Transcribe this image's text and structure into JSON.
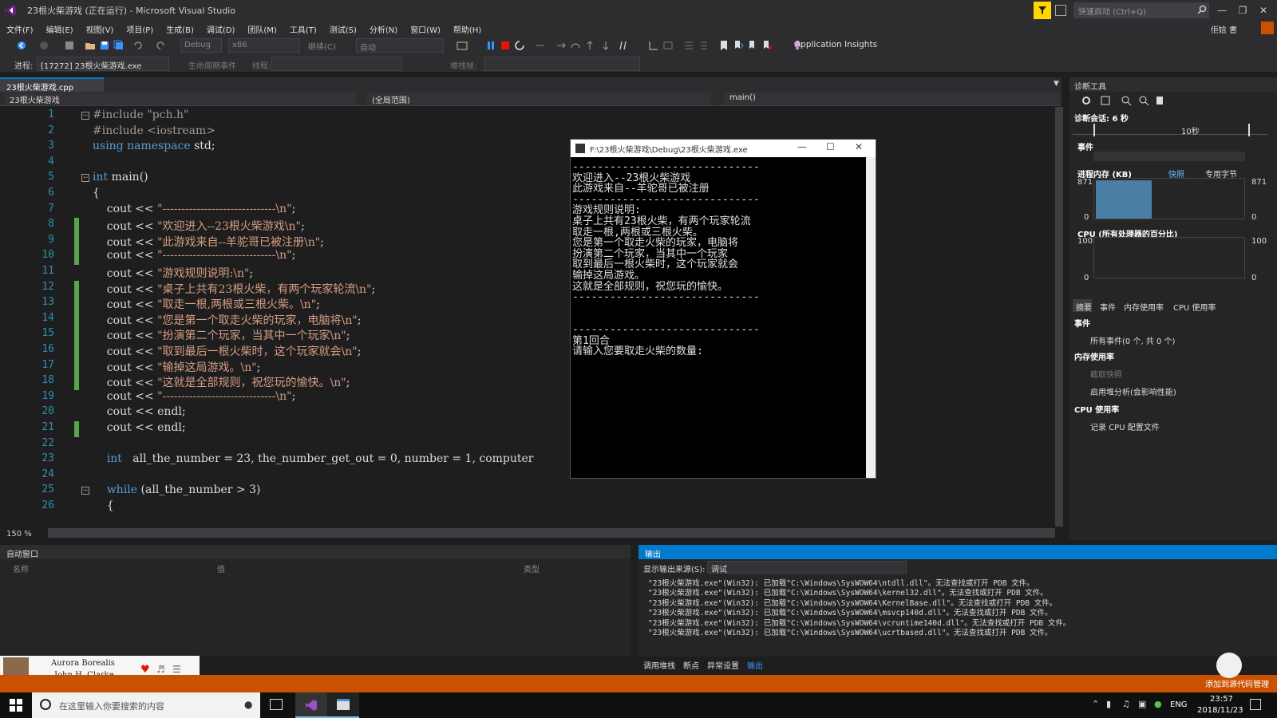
{
  "window": {
    "title": "23根火柴游戏 (正在运行) - Microsoft Visual Studio",
    "quick_launch": "快速启动 (Ctrl+Q)",
    "user": "佢娢 書"
  },
  "menu": [
    "文件(F)",
    "编辑(E)",
    "视图(V)",
    "项目(P)",
    "生成(B)",
    "调试(D)",
    "团队(M)",
    "工具(T)",
    "测试(S)",
    "分析(N)",
    "窗口(W)",
    "帮助(H)"
  ],
  "toolbar": {
    "config": "Debug",
    "platform": "x86",
    "continue": "继续(C)",
    "auto": "自动",
    "app_insights": "Application Insights"
  },
  "procbar": {
    "process_label": "进程:",
    "process": "[17272] 23根火柴游戏.exe",
    "lifecycle": "生命周期事件",
    "thread_label": "线程:",
    "stack_label": "堆栈帧:"
  },
  "editor": {
    "tab": "23根火柴游戏.cpp",
    "nav": {
      "project": "23根火柴游戏",
      "scope": "(全局范围)",
      "func": "main()"
    },
    "zoom": "150 %",
    "lines": [
      {
        "n": "1",
        "t": "#include \"pch.h\""
      },
      {
        "n": "2",
        "t": "#include <iostream>"
      },
      {
        "n": "3",
        "t": "using namespace std;"
      },
      {
        "n": "4",
        "t": ""
      },
      {
        "n": "5",
        "t": "int main()"
      },
      {
        "n": "6",
        "t": "{"
      },
      {
        "n": "7",
        "t": "    cout << \"------------------------------\\n\";"
      },
      {
        "n": "8",
        "t": "    cout << \"欢迎进入--23根火柴游戏\\n\";"
      },
      {
        "n": "9",
        "t": "    cout << \"此游戏来自--羊驼哥已被注册\\n\";"
      },
      {
        "n": "10",
        "t": "    cout << \"------------------------------\\n\";"
      },
      {
        "n": "11",
        "t": "    cout << \"游戏规则说明:\\n\";"
      },
      {
        "n": "12",
        "t": "    cout << \"桌子上共有23根火柴，有两个玩家轮流\\n\";"
      },
      {
        "n": "13",
        "t": "    cout << \"取走一根,两根或三根火柴。\\n\";"
      },
      {
        "n": "14",
        "t": "    cout << \"您是第一个取走火柴的玩家，电脑将\\n\";"
      },
      {
        "n": "15",
        "t": "    cout << \"扮演第二个玩家，当其中一个玩家\\n\";"
      },
      {
        "n": "16",
        "t": "    cout << \"取到最后一根火柴时，这个玩家就会\\n\";"
      },
      {
        "n": "17",
        "t": "    cout << \"输掉这局游戏。\\n\";"
      },
      {
        "n": "18",
        "t": "    cout << \"这就是全部规则，祝您玩的愉快。\\n\";"
      },
      {
        "n": "19",
        "t": "    cout << \"------------------------------\\n\";"
      },
      {
        "n": "20",
        "t": "    cout << endl;"
      },
      {
        "n": "21",
        "t": "    cout << endl;"
      },
      {
        "n": "22",
        "t": ""
      },
      {
        "n": "23",
        "t": "    int   all_the_number = 23, the_number_get_out = 0, number = 1, computer"
      },
      {
        "n": "24",
        "t": ""
      },
      {
        "n": "25",
        "t": "    while (all_the_number > 3)"
      },
      {
        "n": "26",
        "t": "    {"
      }
    ]
  },
  "console": {
    "title": "F:\\23根火柴游戏\\Debug\\23根火柴游戏.exe",
    "lines": [
      "------------------------------",
      "欢迎进入--23根火柴游戏",
      "此游戏来自--羊驼哥已被注册",
      "------------------------------",
      "游戏规则说明:",
      "桌子上共有23根火柴，有两个玩家轮流",
      "取走一根,两根或三根火柴。",
      "您是第一个取走火柴的玩家，电脑将",
      "扮演第二个玩家，当其中一个玩家",
      "取到最后一根火柴时，这个玩家就会",
      "输掉这局游戏。",
      "这就是全部规则，祝您玩的愉快。",
      "------------------------------",
      "",
      "",
      "------------------------------",
      "第1回合",
      "请输入您要取走火柴的数量:"
    ]
  },
  "diag": {
    "title": "诊断工具",
    "session": "诊断会话: 6 秒",
    "timeline": "10秒",
    "events": "事件",
    "memory": "进程内存 (KB)",
    "snapshot": "快照",
    "private": "专用字节",
    "mem_max": "871",
    "mem_min": "0",
    "cpu": "CPU (所有处理器的百分比)",
    "cpu_max": "100",
    "cpu_min": "0",
    "tabs": [
      "摘要",
      "事件",
      "内存使用率",
      "CPU 使用率"
    ],
    "sec_events": "事件",
    "all_events": "所有事件(0 个, 共 0 个)",
    "sec_mem": "内存使用率",
    "take_snapshot": "截取快照",
    "heap": "启用堆分析(会影响性能)",
    "sec_cpu": "CPU 使用率",
    "cpu_profile": "记录 CPU 配置文件"
  },
  "auto_panel": {
    "title": "自动窗口",
    "col_name": "名称",
    "col_value": "值",
    "col_type": "类型"
  },
  "output": {
    "title": "输出",
    "source_label": "显示输出来源(S):",
    "source": "调试",
    "lines": [
      "\"23根火柴游戏.exe\"(Win32): 已加载\"C:\\Windows\\SysWOW64\\ntdll.dll\"。无法查找或打开 PDB 文件。",
      "\"23根火柴游戏.exe\"(Win32): 已加载\"C:\\Windows\\SysWOW64\\kernel32.dll\"。无法查找或打开 PDB 文件。",
      "\"23根火柴游戏.exe\"(Win32): 已加载\"C:\\Windows\\SysWOW64\\KernelBase.dll\"。无法查找或打开 PDB 文件。",
      "\"23根火柴游戏.exe\"(Win32): 已加载\"C:\\Windows\\SysWOW64\\msvcp140d.dll\"。无法查找或打开 PDB 文件。",
      "\"23根火柴游戏.exe\"(Win32): 已加载\"C:\\Windows\\SysWOW64\\vcruntime140d.dll\"。无法查找或打开 PDB 文件。",
      "\"23根火柴游戏.exe\"(Win32): 已加载\"C:\\Windows\\SysWOW64\\ucrtbased.dll\"。无法查找或打开 PDB 文件。"
    ]
  },
  "bottom_tabs": [
    "调用堆栈",
    "断点",
    "异常设置",
    "输出"
  ],
  "status": {
    "right": "添加到源代码管理"
  },
  "music": {
    "song": "Aurora Borealis",
    "artist": "John H. Clarke"
  },
  "taskbar": {
    "search": "在这里输入你要搜索的内容",
    "lang": "ENG",
    "time": "23:57",
    "date": "2018/11/23"
  },
  "colors": {
    "accent": "#007acc",
    "status": "#ca5100",
    "keyword": "#569cd6",
    "string": "#d69d85"
  }
}
